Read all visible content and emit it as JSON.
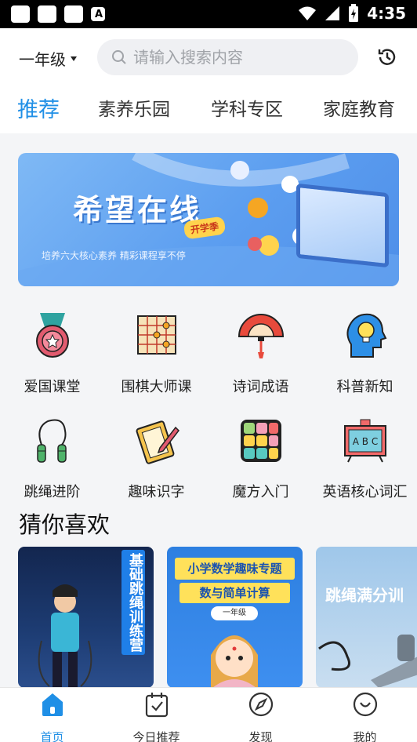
{
  "status_bar": {
    "time": "4:35"
  },
  "header": {
    "grade": "一年级",
    "search_placeholder": "请输入搜索内容"
  },
  "tabs": [
    "推荐",
    "素养乐园",
    "学科专区",
    "家庭教育"
  ],
  "banner": {
    "title": "希望在线",
    "badge": "开学季",
    "subtitle": "培养六大核心素养    精彩课程享不停"
  },
  "grid": [
    {
      "label": "爱国课堂",
      "icon": "medal-icon"
    },
    {
      "label": "围棋大师课",
      "icon": "go-board-icon"
    },
    {
      "label": "诗词成语",
      "icon": "fan-icon"
    },
    {
      "label": "科普新知",
      "icon": "head-bulb-icon"
    },
    {
      "label": "跳绳进阶",
      "icon": "jump-rope-icon"
    },
    {
      "label": "趣味识字",
      "icon": "notebook-pencil-icon"
    },
    {
      "label": "魔方入门",
      "icon": "rubiks-cube-icon"
    },
    {
      "label": "英语核心词汇",
      "icon": "abc-board-icon"
    }
  ],
  "guess": {
    "title": "猜你喜欢",
    "cards": [
      {
        "text": "基础跳绳训练营"
      },
      {
        "text1": "小学数学趣味专题",
        "text2": "数与简单计算",
        "text3": "一年级"
      },
      {
        "text": "跳绳满分训"
      }
    ]
  },
  "bottom_nav": [
    {
      "label": "首页",
      "icon": "home-icon",
      "active": true
    },
    {
      "label": "今日推荐",
      "icon": "calendar-check-icon"
    },
    {
      "label": "发现",
      "icon": "compass-icon"
    },
    {
      "label": "我的",
      "icon": "smiley-icon"
    }
  ]
}
